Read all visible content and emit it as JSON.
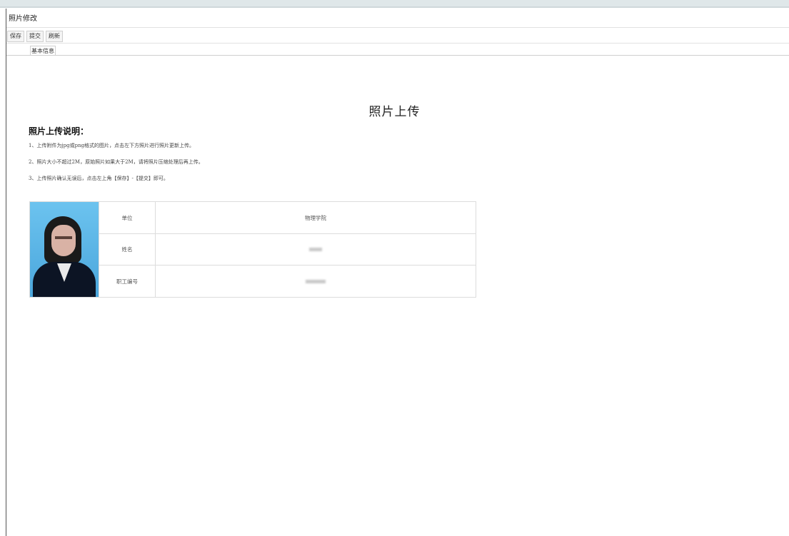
{
  "window": {
    "title": "照片修改"
  },
  "toolbar": {
    "save": "保存",
    "submit": "提交",
    "refresh": "刷新"
  },
  "tabs": [
    {
      "label": "基本信息",
      "active": true
    }
  ],
  "main": {
    "heading": "照片上传",
    "subheading": "照片上传说明：",
    "instructions": [
      "1、上传附件为jpg或png格式的图片，点击左下方照片进行照片更新上传。",
      "2、照片大小不超过2M，原始照片如果大于2M，请将照片压缩处理后再上传。",
      "3、上传照片确认无误后，点击左上角【保存】-【提交】即可。"
    ],
    "info_table": {
      "rows": [
        {
          "label": "单位",
          "value": "物理学院"
        },
        {
          "label": "姓名",
          "value": ""
        },
        {
          "label": "职工编号",
          "value": ""
        }
      ]
    }
  },
  "colors": {
    "photo_background": "#5fb6e6",
    "border": "#dcdcdc"
  }
}
